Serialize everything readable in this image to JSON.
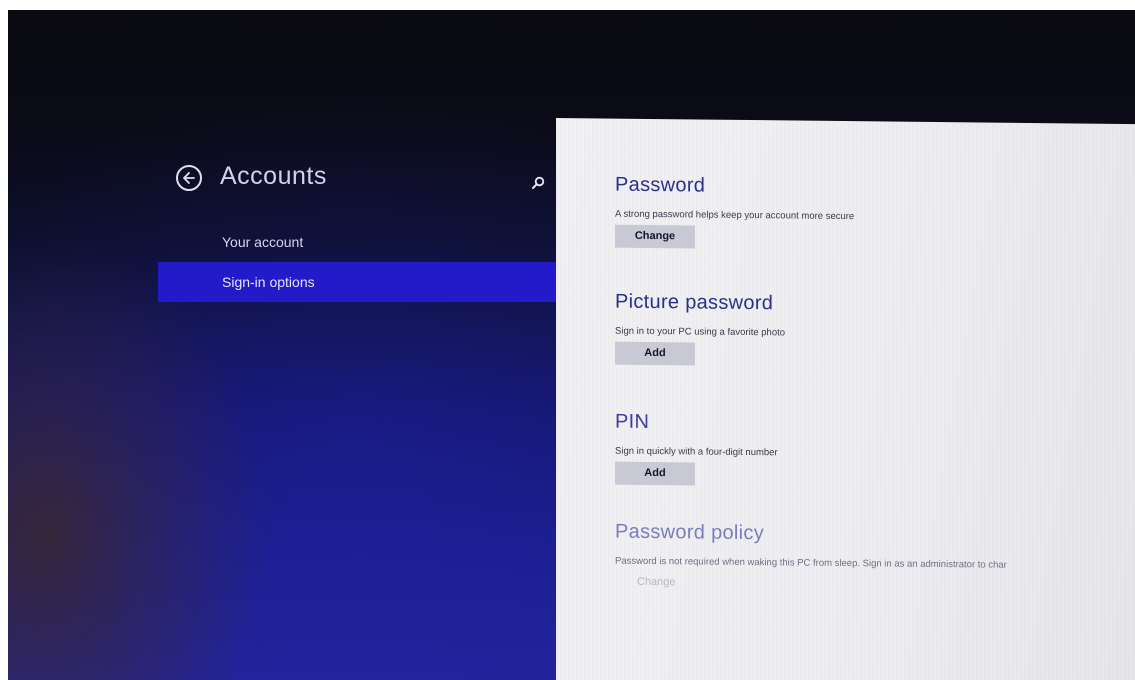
{
  "header": {
    "title": "Accounts"
  },
  "nav": {
    "items": [
      {
        "label": "Your account",
        "selected": false
      },
      {
        "label": "Sign-in options",
        "selected": true
      }
    ]
  },
  "sections": {
    "password": {
      "heading": "Password",
      "description": "A strong password helps keep your account more secure",
      "button": "Change"
    },
    "picture_password": {
      "heading": "Picture password",
      "description": "Sign in to your PC using a favorite photo",
      "button": "Add"
    },
    "pin": {
      "heading": "PIN",
      "description": "Sign in quickly with a four-digit number",
      "button": "Add"
    },
    "password_policy": {
      "heading": "Password policy",
      "description": "Password is not required when waking this PC from sleep. Sign in as an administrator to char",
      "button": "Change"
    }
  },
  "icons": {
    "back": "back-arrow-icon",
    "search": "search-icon"
  },
  "colors": {
    "accent": "#2218c8",
    "left_background": "#14166b",
    "heading": "#2b2e8a",
    "button_bg": "#c9c9d6"
  }
}
